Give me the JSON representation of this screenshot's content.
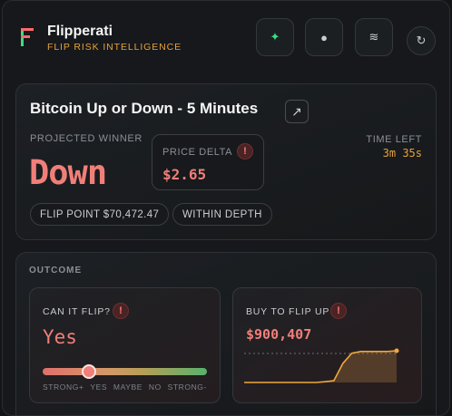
{
  "app": {
    "title": "Flipperati",
    "subtitle": "FLIP RISK INTELLIGENCE",
    "logo_letter": "F"
  },
  "header_buttons": [
    {
      "name": "sparkle-icon",
      "glyph": "✦",
      "color": "#3ddc84"
    },
    {
      "name": "dot-icon",
      "glyph": "●",
      "color": "#c9cdd1"
    },
    {
      "name": "waves-icon",
      "glyph": "≋",
      "color": "#c9cdd1"
    },
    {
      "name": "refresh-icon",
      "glyph": "↻",
      "color": "#c9cdd1"
    }
  ],
  "market": {
    "title": "Bitcoin Up or Down - 5 Minutes",
    "external_icon": "↗",
    "projected_winner_label": "PROJECTED WINNER",
    "projected_winner": "Down",
    "price_delta_label": "PRICE DELTA",
    "price_delta": "$2.65",
    "time_left_label": "TIME LEFT",
    "time_left": "3m 35s",
    "flip_point": "FLIP POINT $70,472.47",
    "depth_status": "WITHIN DEPTH"
  },
  "outcome": {
    "label": "OUTCOME",
    "can_flip": {
      "label": "CAN IT FLIP?",
      "value": "Yes",
      "level": 0.28,
      "scale": [
        "STRONG+",
        "YES",
        "MAYBE",
        "NO",
        "STRONG-"
      ]
    },
    "buy_to_flip": {
      "label": "BUY TO FLIP UP",
      "value": "$900,407",
      "sparkline": [
        0,
        0,
        0,
        0,
        0,
        0,
        0,
        0,
        0,
        0.02,
        0.05,
        0.55,
        0.85,
        0.9,
        0.9,
        0.9,
        0.9,
        0.92
      ]
    }
  },
  "warning_glyph": "!",
  "colors": {
    "accent_orange": "#e6a23c",
    "down_red": "#f07f79",
    "green": "#3ddc84"
  }
}
